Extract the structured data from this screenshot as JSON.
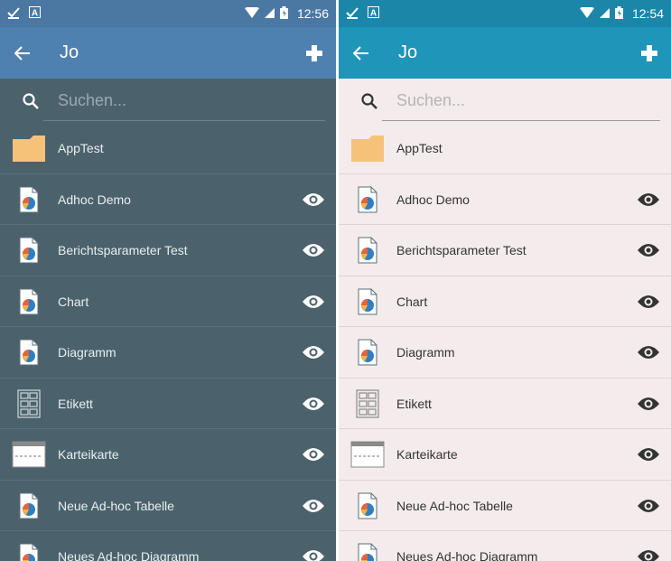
{
  "left": {
    "status": {
      "time": "12:56"
    },
    "title": "Jo",
    "search": {
      "placeholder": "Suchen..."
    },
    "items": [
      {
        "label": "AppTest",
        "icon": "folder-icon",
        "eye": false
      },
      {
        "label": "Adhoc Demo",
        "icon": "report-chart-icon",
        "eye": true
      },
      {
        "label": "Berichtsparameter Test",
        "icon": "report-chart-icon",
        "eye": true
      },
      {
        "label": "Chart",
        "icon": "report-chart-icon",
        "eye": true
      },
      {
        "label": "Diagramm",
        "icon": "report-chart-icon",
        "eye": true
      },
      {
        "label": "Etikett",
        "icon": "label-grid-icon",
        "eye": true
      },
      {
        "label": "Karteikarte",
        "icon": "index-card-icon",
        "eye": true
      },
      {
        "label": "Neue Ad-hoc Tabelle",
        "icon": "report-chart-icon",
        "eye": true
      },
      {
        "label": "Neues Ad-hoc Diagramm",
        "icon": "report-chart-icon",
        "eye": true
      }
    ]
  },
  "right": {
    "status": {
      "time": "12:54"
    },
    "title": "Jo",
    "search": {
      "placeholder": "Suchen..."
    },
    "items": [
      {
        "label": "AppTest",
        "icon": "folder-icon",
        "eye": false
      },
      {
        "label": "Adhoc Demo",
        "icon": "report-chart-icon",
        "eye": true
      },
      {
        "label": "Berichtsparameter Test",
        "icon": "report-chart-icon",
        "eye": true
      },
      {
        "label": "Chart",
        "icon": "report-chart-icon",
        "eye": true
      },
      {
        "label": "Diagramm",
        "icon": "report-chart-icon",
        "eye": true
      },
      {
        "label": "Etikett",
        "icon": "label-grid-icon",
        "eye": true
      },
      {
        "label": "Karteikarte",
        "icon": "index-card-icon",
        "eye": true
      },
      {
        "label": "Neue Ad-hoc Tabelle",
        "icon": "report-chart-icon",
        "eye": true
      },
      {
        "label": "Neues Ad-hoc Diagramm",
        "icon": "report-chart-icon",
        "eye": true
      }
    ]
  },
  "colors": {
    "dark_appbar": "#4f81b0",
    "dark_list_bg": "#4b626c",
    "light_appbar": "#1f95b9",
    "light_list_bg": "#f4ecec",
    "folder": "#f6c27a"
  }
}
